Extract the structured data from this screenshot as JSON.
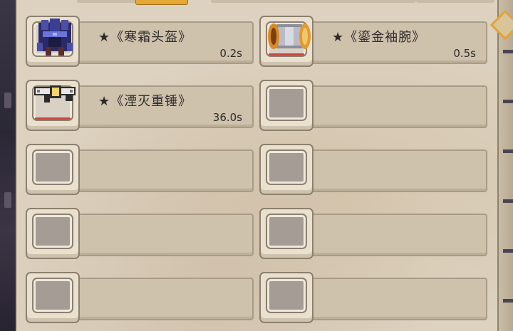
{
  "inventory": {
    "slots": [
      {
        "name": "★《寒霜头盔》",
        "time": "0.2s",
        "icon": "frost-helmet-icon"
      },
      {
        "name": "★《鎏金袖腕》",
        "time": "0.5s",
        "icon": "gilded-bracer-icon"
      },
      {
        "name": "★《湮灭重锤》",
        "time": "36.0s",
        "icon": "annihilation-hammer-icon"
      },
      {
        "name": "",
        "time": ""
      },
      {
        "name": "",
        "time": ""
      },
      {
        "name": "",
        "time": ""
      },
      {
        "name": "",
        "time": ""
      },
      {
        "name": "",
        "time": ""
      },
      {
        "name": "",
        "time": ""
      },
      {
        "name": "",
        "time": ""
      }
    ]
  },
  "colors": {
    "panel_bg": "#ddd2c0",
    "slot_bar": "#cfc2ad",
    "accent_gold": "#e4a836",
    "text": "#2e2a2a"
  }
}
